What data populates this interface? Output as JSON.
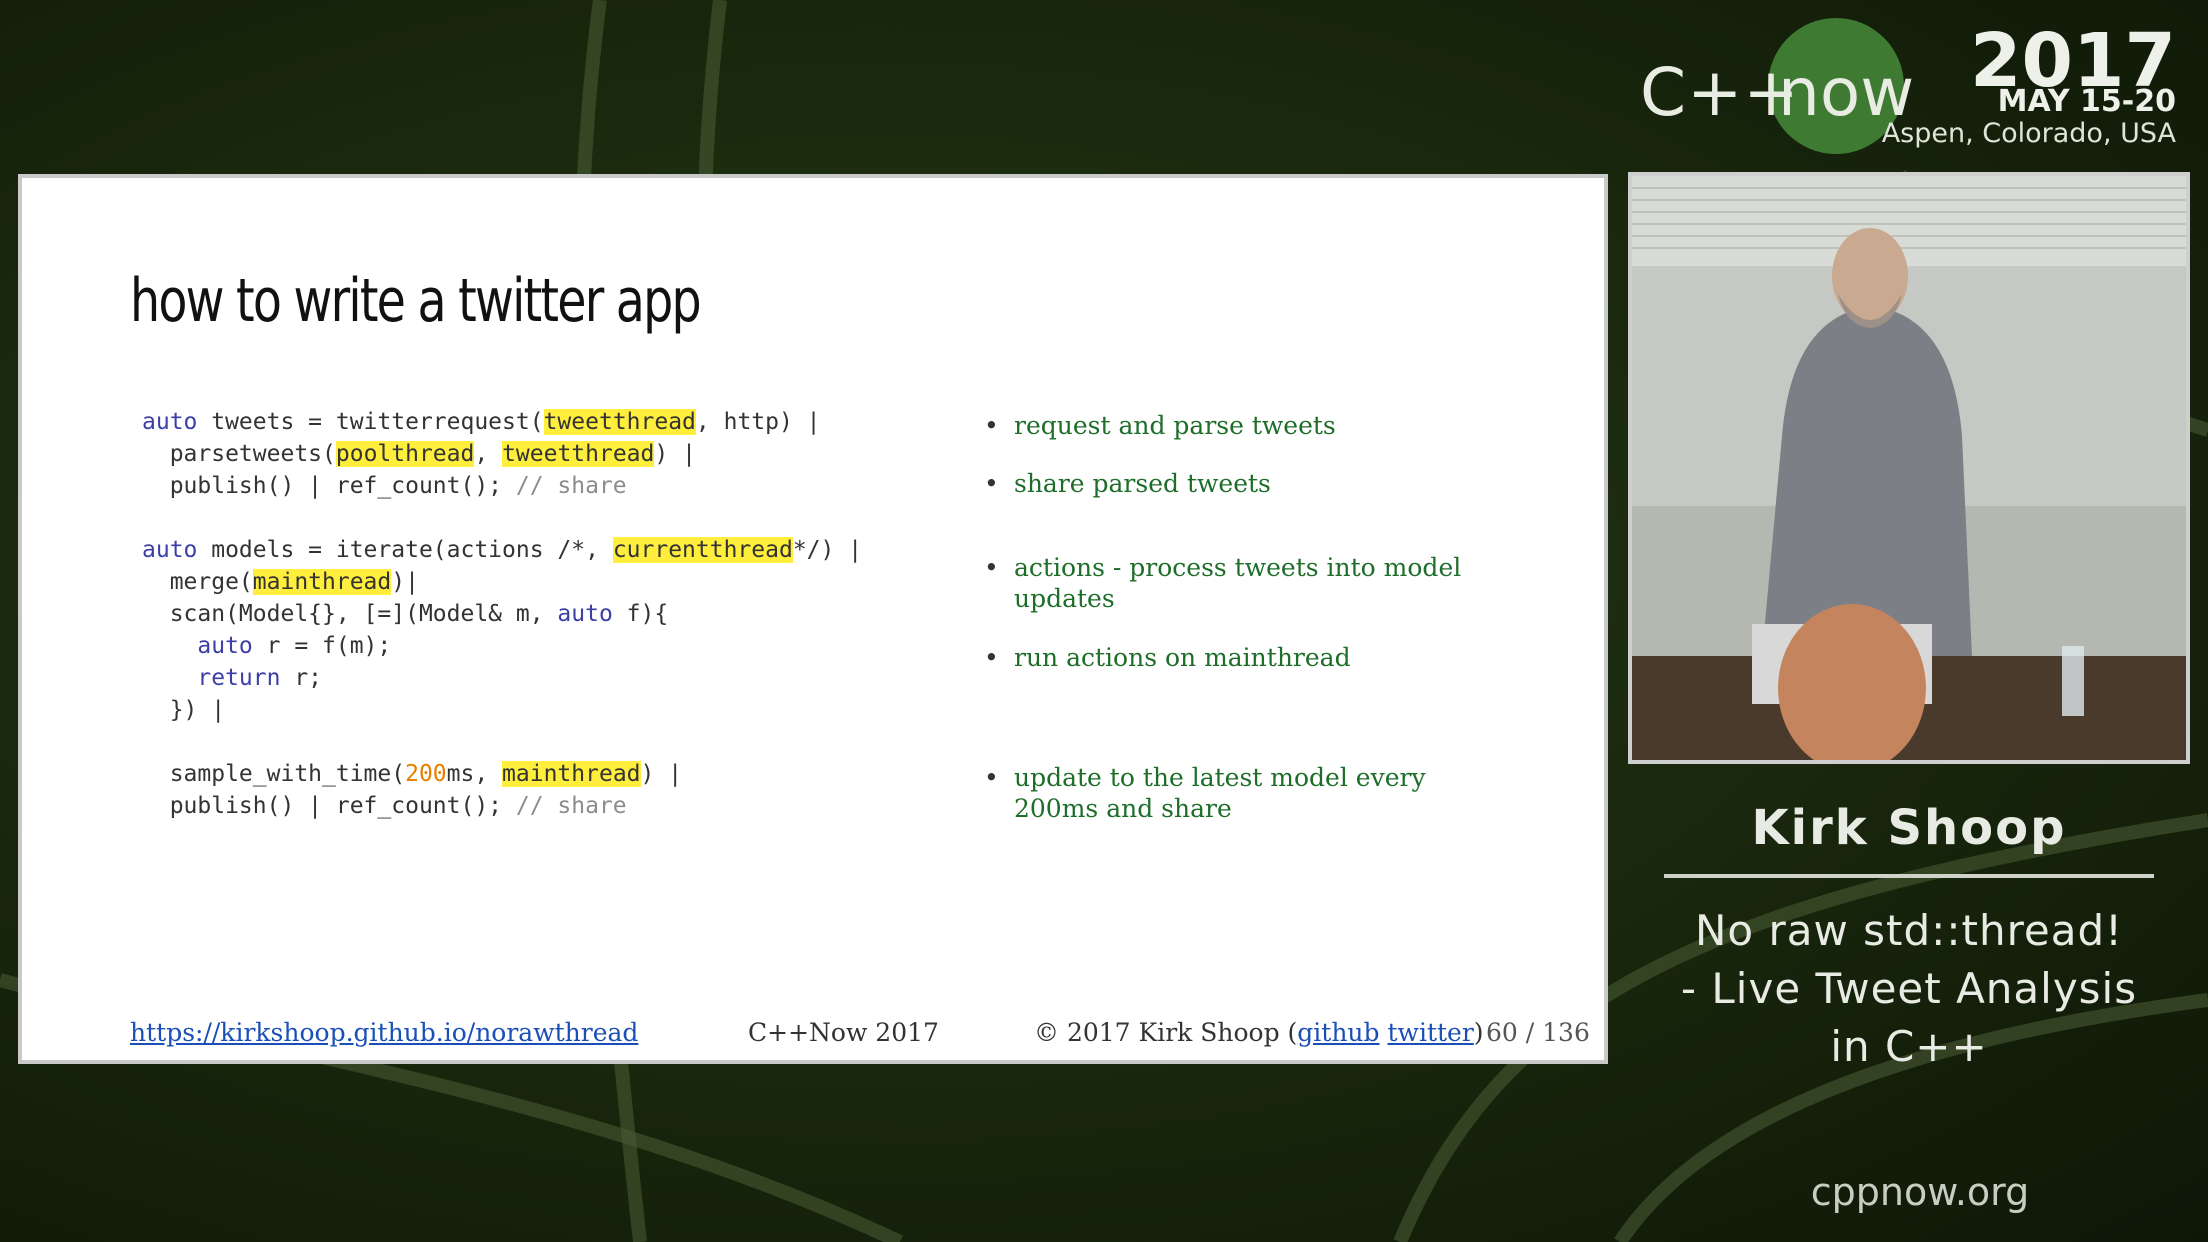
{
  "branding": {
    "cpp": "C++",
    "now": "now",
    "year": "2017",
    "dates": "MAY 15-20",
    "location": "Aspen, Colorado, USA"
  },
  "slide": {
    "title": "how to write a twitter app",
    "code_lines": [
      [
        {
          "t": "auto",
          "c": "kw"
        },
        {
          "t": " tweets = twitterrequest("
        },
        {
          "t": "tweetthread",
          "c": "hl"
        },
        {
          "t": ", http) |"
        }
      ],
      [
        {
          "t": "  parsetweets("
        },
        {
          "t": "poolthread",
          "c": "hl"
        },
        {
          "t": ", "
        },
        {
          "t": "tweetthread",
          "c": "hl"
        },
        {
          "t": ") |"
        }
      ],
      [
        {
          "t": "  publish() | ref_count(); "
        },
        {
          "t": "// share",
          "c": "cm"
        }
      ],
      [
        {
          "t": ""
        }
      ],
      [
        {
          "t": "auto",
          "c": "kw"
        },
        {
          "t": " models = iterate(actions /*, "
        },
        {
          "t": "currentthread",
          "c": "hl"
        },
        {
          "t": "*/) |"
        }
      ],
      [
        {
          "t": "  merge("
        },
        {
          "t": "mainthread",
          "c": "hl"
        },
        {
          "t": ")|"
        }
      ],
      [
        {
          "t": "  scan(Model{}, [=](Model& m, "
        },
        {
          "t": "auto",
          "c": "kw"
        },
        {
          "t": " f){"
        }
      ],
      [
        {
          "t": "    "
        },
        {
          "t": "auto",
          "c": "kw"
        },
        {
          "t": " r = f(m);"
        }
      ],
      [
        {
          "t": "    "
        },
        {
          "t": "return",
          "c": "kw"
        },
        {
          "t": " r;"
        }
      ],
      [
        {
          "t": "  }) |"
        }
      ],
      [
        {
          "t": ""
        }
      ],
      [
        {
          "t": "  sample_with_time("
        },
        {
          "t": "200",
          "c": "num"
        },
        {
          "t": "ms, "
        },
        {
          "t": "mainthread",
          "c": "hl"
        },
        {
          "t": ") |"
        }
      ],
      [
        {
          "t": "  publish() | ref_count(); "
        },
        {
          "t": "// share",
          "c": "cm"
        }
      ]
    ],
    "bullets": [
      "request and parse tweets",
      "share parsed tweets",
      "actions - process tweets into model updates",
      "run actions on mainthread",
      "update to the latest model every 200ms and share"
    ],
    "footer": {
      "url": "https://kirkshoop.github.io/norawthread",
      "conference": "C++Now 2017",
      "copyright_prefix": "© 2017 Kirk Shoop (",
      "github": "github",
      "twitter": "twitter",
      "copyright_suffix": ")",
      "page": "60 / 136"
    }
  },
  "speaker": {
    "name": "Kirk Shoop",
    "talk_title_lines": [
      "No raw std::thread!",
      "- Live Tweet Analysis",
      "in C++"
    ]
  },
  "site": "cppnow.org",
  "colors": {
    "accent_green": "#3f7a32",
    "bullet_text": "#1e6e2a",
    "highlight": "#ffef3c",
    "keyword": "#3b3fa6",
    "link": "#1a4fb8"
  }
}
